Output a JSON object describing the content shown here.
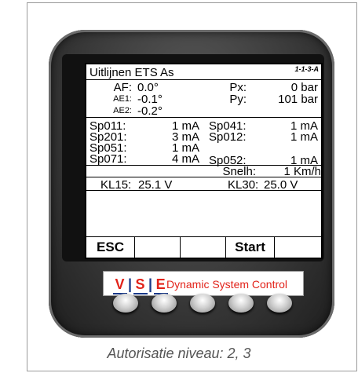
{
  "screen": {
    "title": "Uitlijnen ETS As",
    "code": "1-1-3-A",
    "af_label": "AF:",
    "af_value": "0.0°",
    "ae1_label": "AE1:",
    "ae1_value": "-0.1°",
    "ae2_label": "AE2:",
    "ae2_value": "-0.2°",
    "px_label": "Px:",
    "px_value": "0 bar",
    "py_label": "Py:",
    "py_value": "101 bar",
    "sensors": [
      {
        "label": "Sp011:",
        "value": "1 mA"
      },
      {
        "label": "Sp201:",
        "value": "3 mA"
      },
      {
        "label": "Sp051:",
        "value": "1 mA"
      },
      {
        "label": "Sp071:",
        "value": "4 mA"
      },
      {
        "label": "Sp041:",
        "value": "1 mA"
      },
      {
        "label": "Sp012:",
        "value": "1 mA"
      },
      {
        "label": "Sp052:",
        "value": "1 mA"
      }
    ],
    "speed_label": "Snelh:",
    "speed_value": "1 Km/h",
    "kl15_label": "KL15:",
    "kl15_value": "25.1 V",
    "kl30_label": "KL30:",
    "kl30_value": "25.0 V"
  },
  "softkeys": {
    "esc": "ESC",
    "start": "Start"
  },
  "logo": {
    "v": "V",
    "s": "S",
    "e": "E",
    "text": "Dynamic System Control"
  },
  "caption": "Autorisatie niveau: 2, 3"
}
